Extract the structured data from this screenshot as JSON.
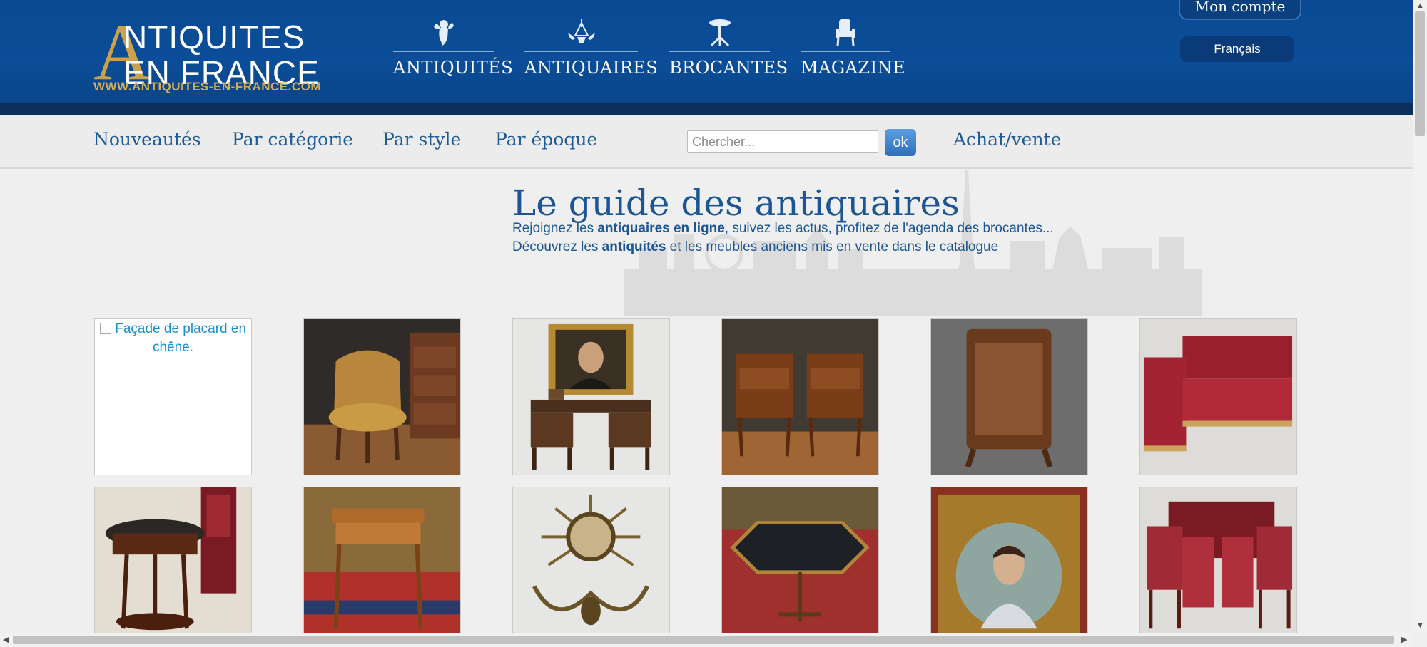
{
  "header": {
    "logo": {
      "letter": "A",
      "line1": "NTIQUITES",
      "line2": "EN FRANCE",
      "url": "WWW.ANTIQUITES-EN-FRANCE.COM"
    },
    "nav": [
      {
        "label": "ANTIQUITÉS",
        "icon": "cherub-icon"
      },
      {
        "label": "ANTIQUAIRES",
        "icon": "chandelier-icon"
      },
      {
        "label": "BROCANTES",
        "icon": "gueridon-table-icon"
      },
      {
        "label": "MAGAZINE",
        "icon": "armchair-icon"
      }
    ],
    "account_label": "Mon compte",
    "language": "Français"
  },
  "subnav": {
    "links": [
      "Nouveautés",
      "Par catégorie",
      "Par style",
      "Par époque"
    ],
    "search_placeholder": "Chercher...",
    "search_button": "ok",
    "achat_vente": "Achat/vente"
  },
  "hero": {
    "title": "Le guide des antiquaires",
    "line1": {
      "before": "Rejoignez les ",
      "bold": "antiquaires en ligne",
      "after": ", suivez les actus, profitez de l'agenda des brocantes..."
    },
    "line2": {
      "before": "Découvrez les ",
      "bold": "antiquités",
      "after": " et les meubles anciens mis en vente dans le catalogue"
    }
  },
  "gallery": {
    "row1": [
      {
        "alt": "Façade de placard en chêne.",
        "subject": "broken-image"
      },
      {
        "subject": "leather-bergere-armchair"
      },
      {
        "subject": "desk-with-portrait-painting"
      },
      {
        "subject": "pair-of-marquetry-nightstands"
      },
      {
        "subject": "carved-wood-fire-screen"
      },
      {
        "subject": "red-corner-sofa"
      }
    ],
    "row2": [
      {
        "subject": "empire-gueridon-and-chair"
      },
      {
        "subject": "small-writing-table-on-rug"
      },
      {
        "subject": "sunburst-mirror-sconce"
      },
      {
        "subject": "octagonal-marquetry-table"
      },
      {
        "subject": "gilt-framed-portrait"
      },
      {
        "subject": "empire-salon-suite"
      }
    ]
  },
  "colors": {
    "header_blue": "#0b4d98",
    "header_strip": "#0d2f5c",
    "logo_gold": "#c9a24a",
    "link_blue": "#1e5a96",
    "page_bg": "#efefef"
  }
}
